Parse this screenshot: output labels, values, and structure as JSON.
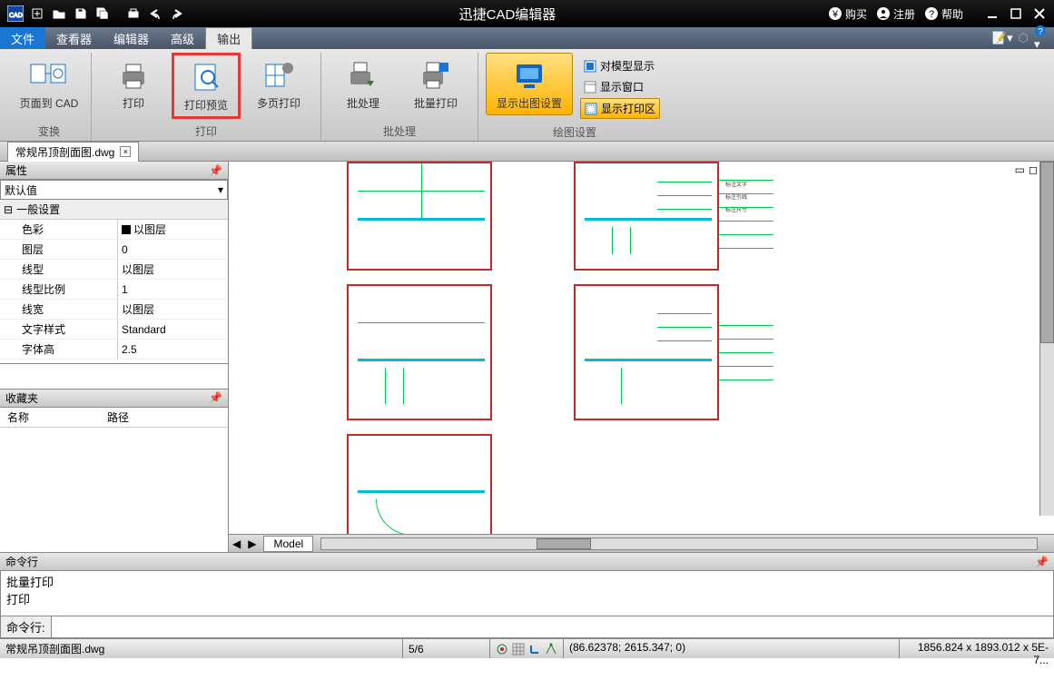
{
  "title": "迅捷CAD编辑器",
  "titlebar_right": {
    "buy": "购买",
    "register": "注册",
    "help": "帮助"
  },
  "menu": {
    "file": "文件",
    "viewer": "查看器",
    "editor": "编辑器",
    "advanced": "高级",
    "output": "输出"
  },
  "ribbon": {
    "groups": {
      "transform": {
        "label": "变换",
        "page_to_cad": "页面到 CAD"
      },
      "print": {
        "label": "打印",
        "print": "打印",
        "preview": "打印预览",
        "multi": "多页打印"
      },
      "batch": {
        "label": "批处理",
        "batch": "批处理",
        "batch_print": "批量打印"
      },
      "plot": {
        "label": "绘图设置",
        "show_settings": "显示出图设置",
        "show_model": "对模型显示",
        "show_window": "显示窗口",
        "show_print_area": "显示打印区"
      }
    }
  },
  "file_tab": "常规吊顶剖面图.dwg",
  "props": {
    "title": "属性",
    "default_val": "默认值",
    "general": "一般设置",
    "rows": [
      {
        "name": "色彩",
        "val": "以图层",
        "swatch": true
      },
      {
        "name": "图层",
        "val": "0"
      },
      {
        "name": "线型",
        "val": "以图层"
      },
      {
        "name": "线型比例",
        "val": "1"
      },
      {
        "name": "线宽",
        "val": "以图层"
      },
      {
        "name": "文字样式",
        "val": "Standard"
      },
      {
        "name": "字体高",
        "val": "2.5"
      }
    ]
  },
  "favorites": {
    "title": "收藏夹",
    "col_name": "名称",
    "col_path": "路径"
  },
  "model_tab": "Model",
  "command": {
    "title": "命令行",
    "log1": "批量打印",
    "log2": "打印",
    "prompt": "命令行:"
  },
  "status": {
    "file": "常规吊顶剖面图.dwg",
    "page": "5/6",
    "coords": "(86.62378; 2615.347; 0)",
    "zoom": "1856.824 x 1893.012 x 5E-7..."
  }
}
